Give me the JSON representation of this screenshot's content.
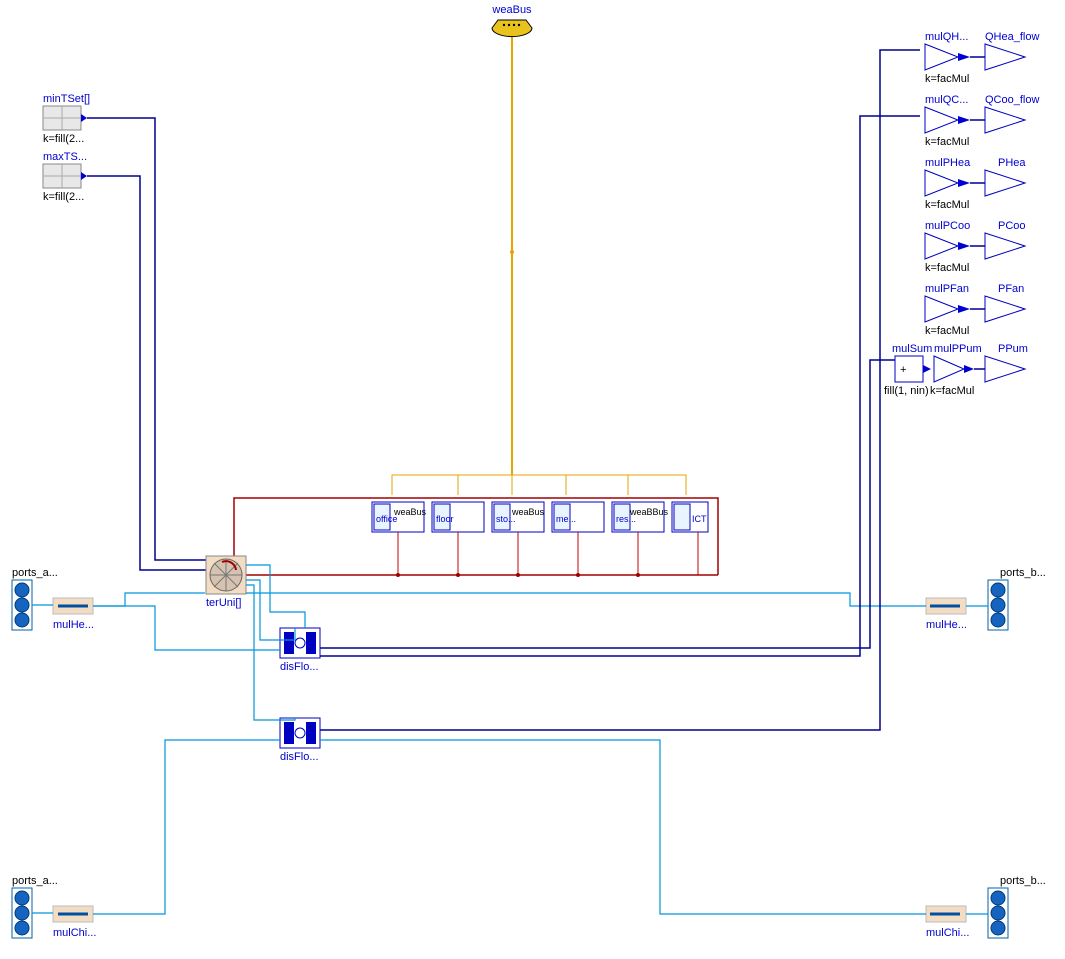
{
  "top": {
    "weaBus": "weaBus"
  },
  "left": {
    "minTSet": {
      "label": "minTSet[]",
      "k": "k=fill(2..."
    },
    "maxTS": {
      "label": "maxTS...",
      "k": "k=fill(2..."
    },
    "ports_a_top": "ports_a...",
    "mulHe_top": "mulHe...",
    "ports_a_bot": "ports_a...",
    "mulChi_bot": "mulChi..."
  },
  "right": {
    "ports_b_top": "ports_b...",
    "mulHe_top": "mulHe...",
    "ports_b_bot": "ports_b...",
    "mulChi_bot": "mulChi..."
  },
  "zones": {
    "labels": [
      "office",
      "floor",
      "sto...",
      "me...",
      "res...",
      "ICT"
    ],
    "weaBus": "weaBus",
    "weaB": "weaB...",
    "weaB2": "weaBBus"
  },
  "center": {
    "terUni": "terUni[]",
    "disFlo1": "disFlo...",
    "disFlo2": "disFlo..."
  },
  "outputs": [
    {
      "g": "mulQH...",
      "k": "k=facMul",
      "out": "QHea_flow"
    },
    {
      "g": "mulQC...",
      "k": "k=facMul",
      "out": "QCoo_flow"
    },
    {
      "g": "mulPHea",
      "k": "k=facMul",
      "out": "PHea"
    },
    {
      "g": "mulPCoo",
      "k": "k=facMul",
      "out": "PCoo"
    },
    {
      "g": "mulPFan",
      "k": "k=facMul",
      "out": "PFan"
    },
    {
      "g": "mulPPum",
      "k": "k=facMul",
      "out": "PPum"
    }
  ],
  "mulSum": {
    "label": "mulSum",
    "fill": "fill(1, nin)",
    "plus": "+"
  }
}
